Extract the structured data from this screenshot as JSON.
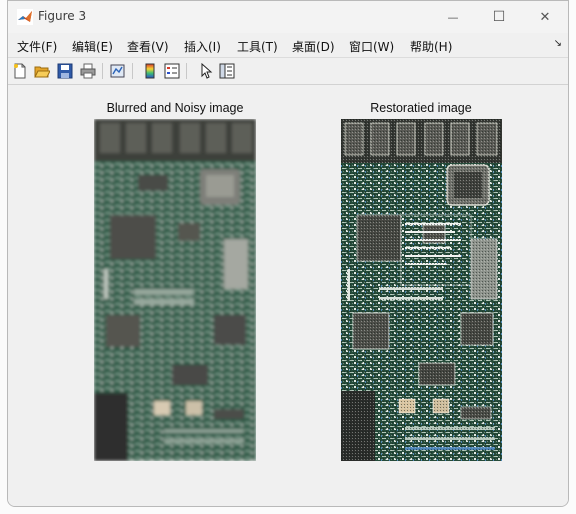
{
  "window": {
    "title": "Figure 3",
    "controls": {
      "minimize": "—",
      "maximize": "☐",
      "close": "✕"
    }
  },
  "menubar": {
    "items": [
      "文件(F)",
      "编辑(E)",
      "查看(V)",
      "插入(I)",
      "工具(T)",
      "桌面(D)",
      "窗口(W)",
      "帮助(H)"
    ],
    "overflow_arrow": "↘"
  },
  "toolbar": {
    "buttons": [
      "new-figure-icon",
      "open-file-icon",
      "save-icon",
      "print-icon",
      "link-plot-icon",
      "insert-colorbar-icon",
      "insert-legend-icon",
      "edit-plot-pointer-icon",
      "property-inspector-icon"
    ]
  },
  "axes": [
    {
      "title": "Blurred and Noisy image",
      "image": "blurred-circuit-board"
    },
    {
      "title": "Restoratied image",
      "image": "restored-circuit-board"
    }
  ],
  "colors": {
    "pcb_green": "#2e5b48",
    "pcb_dark": "#1d3a2f",
    "chip_gray": "#6d6d6a",
    "title_bar": "#f3f3f3",
    "background": "#f0f0f0"
  }
}
